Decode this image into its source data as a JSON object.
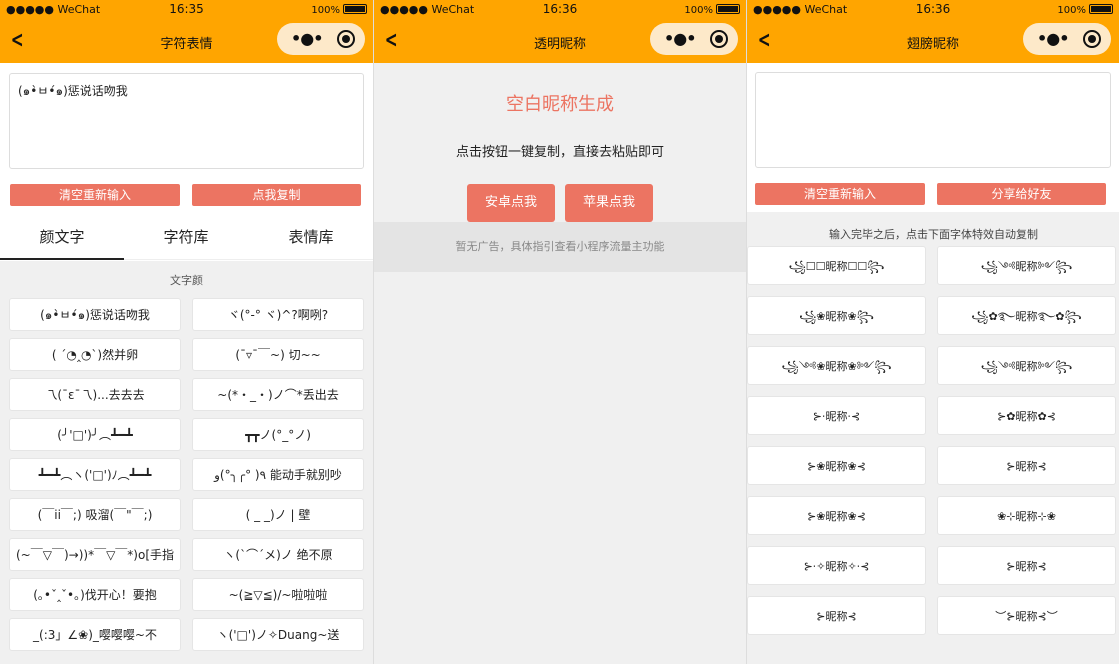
{
  "status": {
    "carrier": "●●●●● WeChat",
    "battery": "100%"
  },
  "screens": [
    {
      "time": "16:35",
      "title": "字符表情"
    },
    {
      "time": "16:36",
      "title": "透明昵称"
    },
    {
      "time": "16:36",
      "title": "翅膀昵称"
    }
  ],
  "capsule": {
    "dots": "•●•"
  },
  "p1": {
    "input_value": "(๑•̀ㅂ•́๑)惩说话吻我",
    "clear_label": "清空重新输入",
    "copy_label": "点我复制",
    "tabs": [
      "颜文字",
      "字符库",
      "表情库"
    ],
    "section_title": "文字颜",
    "items": [
      "(๑•̀ㅂ•́๑)惩说话吻我",
      "ヾ(°-° ヾ)^?啊咧?",
      "( ´◔‸◔`)然并卵",
      "(¯▿¯￣~) 切~~",
      "乁(ˉεˉ乁)...去去去",
      "~(*・_・)ノ⌒*丢出去",
      "(╯'□')╯︵┻━┻",
      "┳┳ノ(°_°ノ)",
      "┻━┻︵ヽ('□')ﾉ︵┻━┻",
      "٩( °╭╮°)و 能动手就别吵",
      "(￣ii￣;) 吸溜(￣\"￣;)",
      "( _ _)ノ | 壁",
      "(~￣▽￣)→))*￣▽￣*)o[手指",
      "ヽ(`⌒´メ)ノ 绝不原",
      "(｡•ˇ‸ˇ•｡)伐开心！要抱",
      "~(≧▽≦)/~啦啦啦",
      "_(:3」∠❀)_嘤嘤嘤~不",
      "ヽ('□')ノ✧Duang~送"
    ]
  },
  "p2": {
    "title": "空白昵称生成",
    "sub": "点击按钮一键复制，直接去粘贴即可",
    "android_label": "安卓点我",
    "apple_label": "苹果点我",
    "ad_text": "暂无广告，具体指引查看小程序流量主功能"
  },
  "p3": {
    "clear_label": "清空重新输入",
    "share_label": "分享给好友",
    "hint": "输入完毕之后，点击下面字体特效自动复制",
    "items": [
      "꧁☐☐昵称☐☐꧂",
      "꧁༺昵称༻꧂",
      "꧁❀昵称❀꧂",
      "꧁✿࿐昵称࿐✿꧂",
      "꧁༺❀昵称❀༻꧂",
      "꧁༺昵称༻꧂",
      "⊱⋅昵称⋅⊰",
      "⊱✿昵称✿⊰",
      "⊱❀昵称❀⊰",
      "⊱昵称⊰",
      "⊱❀昵称❀⊰",
      "❀⊹昵称⊹❀",
      "⊱⋅✧昵称✧⋅⊰",
      "⊱昵称⊰",
      "⊱昵称⊰",
      "︶⊱昵称⊰︶"
    ]
  }
}
